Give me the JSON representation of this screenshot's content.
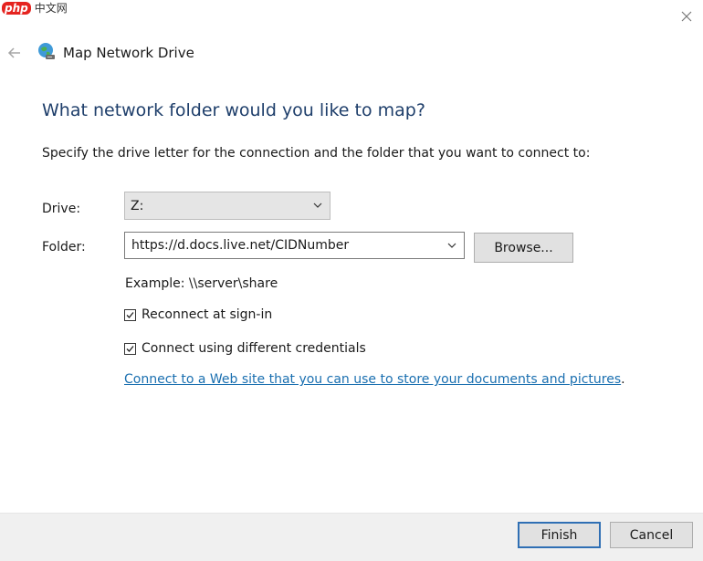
{
  "watermark": {
    "logo": "php",
    "text": "中文网"
  },
  "window": {
    "title": "Map Network Drive"
  },
  "heading": "What network folder would you like to map?",
  "instruction": "Specify the drive letter for the connection and the folder that you want to connect to:",
  "drive": {
    "label": "Drive:",
    "value": "Z:"
  },
  "folder": {
    "label": "Folder:",
    "value": "https://d.docs.live.net/CIDNumber",
    "browse_label": "Browse..."
  },
  "example": "Example: \\\\server\\share",
  "options": {
    "reconnect": {
      "label": "Reconnect at sign-in",
      "checked": true
    },
    "credentials": {
      "label": "Connect using different credentials",
      "checked": true
    }
  },
  "link": {
    "text": "Connect to a Web site that you can use to store your documents and pictures",
    "suffix": "."
  },
  "footer": {
    "finish_label": "Finish",
    "cancel_label": "Cancel"
  },
  "icons": {
    "close": "close-icon",
    "back": "back-arrow-icon",
    "title": "network-drive-icon",
    "dropdown": "chevron-down-icon",
    "check": "checkmark-icon"
  },
  "colors": {
    "heading": "#1f3f6b",
    "link": "#1a6fb0",
    "finish_border": "#2f6fb4"
  }
}
